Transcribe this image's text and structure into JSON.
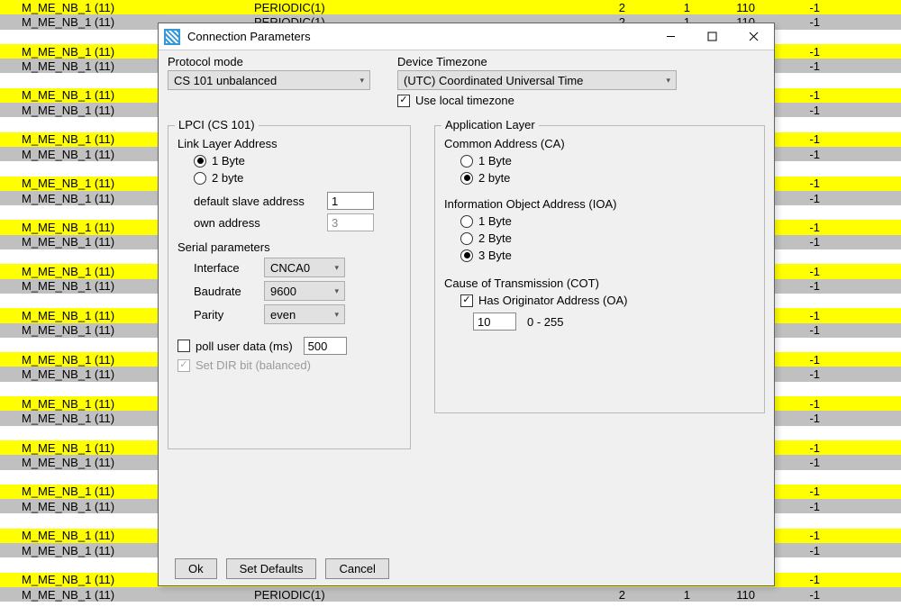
{
  "bg": {
    "name_text": "M_ME_NB_1 (11)",
    "mid_text": "PERIODIC(1)",
    "cols": [
      "2",
      "1",
      "110",
      "-1"
    ]
  },
  "titlebar": {
    "title": "Connection Parameters"
  },
  "protocol_mode": {
    "label": "Protocol mode",
    "value": "CS 101 unbalanced"
  },
  "timezone": {
    "label": "Device Timezone",
    "value": "(UTC) Coordinated Universal Time",
    "use_local_label": "Use local timezone",
    "use_local_checked": true
  },
  "lpci": {
    "title": "LPCI (CS 101)",
    "link_layer": {
      "title": "Link Layer Address",
      "opt1": "1 Byte",
      "opt2": "2 byte",
      "selected": 1,
      "default_slave_label": "default slave address",
      "default_slave_value": "1",
      "own_label": "own address",
      "own_value": "3"
    },
    "serial": {
      "title": "Serial parameters",
      "interface_label": "Interface",
      "interface_value": "CNCA0",
      "baudrate_label": "Baudrate",
      "baudrate_value": "9600",
      "parity_label": "Parity",
      "parity_value": "even"
    },
    "poll_label": "poll user data (ms)",
    "poll_checked": false,
    "poll_value": "500",
    "dir_label": "Set DIR bit (balanced)",
    "dir_checked": true
  },
  "app_layer": {
    "title": "Application Layer",
    "ca": {
      "title": "Common Address (CA)",
      "opt1": "1 Byte",
      "opt2": "2 byte",
      "selected": 2
    },
    "ioa": {
      "title": "Information Object Address (IOA)",
      "opt1": "1 Byte",
      "opt2": "2 Byte",
      "opt3": "3 Byte",
      "selected": 3
    },
    "cot": {
      "title": "Cause of Transmission (COT)",
      "has_oa_label": "Has Originator Address (OA)",
      "has_oa_checked": true,
      "oa_value": "10",
      "range": "0 - 255"
    }
  },
  "footer": {
    "ok": "Ok",
    "defaults": "Set Defaults",
    "cancel": "Cancel"
  }
}
